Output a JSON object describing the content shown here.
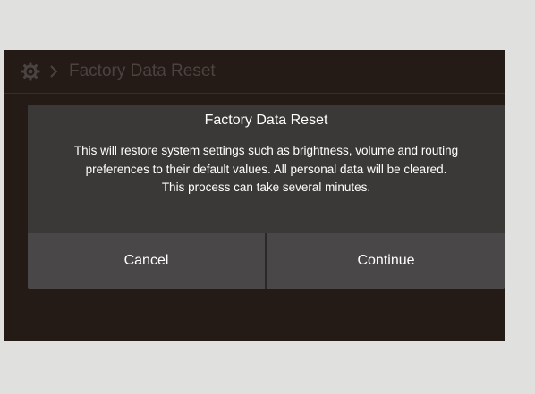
{
  "header": {
    "breadcrumb_label": "Factory Data Reset"
  },
  "dialog": {
    "title": "Factory Data Reset",
    "message": "This will restore system settings such as brightness, volume and routing preferences to their default values. All personal data will be cleared.",
    "note": "This process can take several minutes.",
    "cancel_label": "Cancel",
    "continue_label": "Continue"
  },
  "colors": {
    "screen_background": "#241a16",
    "dialog_background": "#3b3937",
    "button_background": "#494747",
    "header_text": "#4a4441",
    "dialog_text": "#ffffff"
  },
  "icons": {
    "settings": "gear-icon",
    "separator": "chevron-right-icon"
  }
}
